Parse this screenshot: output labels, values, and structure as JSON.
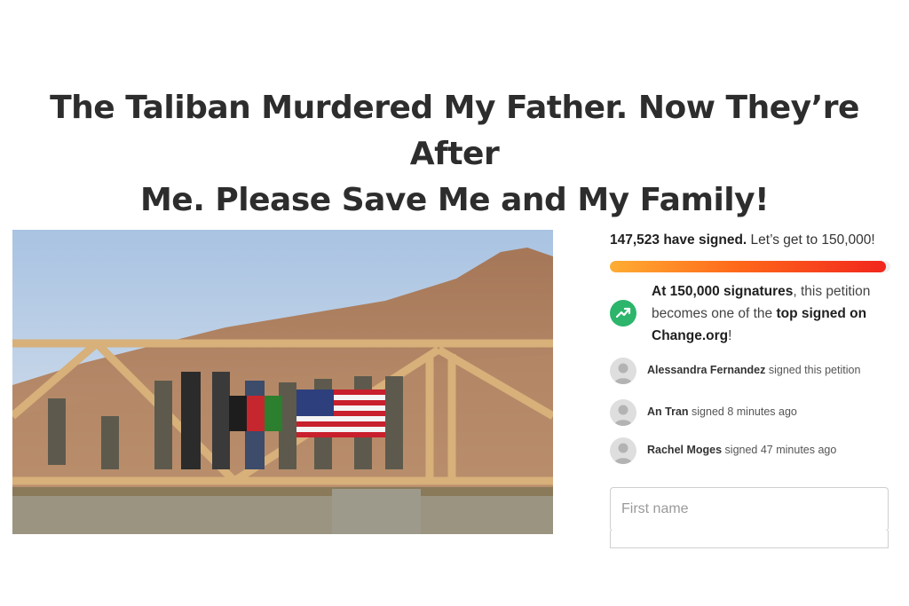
{
  "petition": {
    "title_line1": "The Taliban Murdered My Father. Now They’re After",
    "title_line2": "Me. Please Save Me and My Family!"
  },
  "photo": {
    "description_icon": "petition-photo"
  },
  "signatures": {
    "count_text": "147,523 have signed.",
    "goal_text": " Let’s get to 150,000!",
    "progress": 0.983,
    "progress_colors": [
      "#ffad33",
      "#ff6a1a",
      "#f1261d"
    ]
  },
  "milestone": {
    "icon": "trending-up-icon",
    "icon_color": "#2cb56b",
    "bold1": "At 150,000 signatures",
    "text1": ", this petition becomes one of the ",
    "bold2": "top signed on Change.org",
    "text2": "!"
  },
  "recent_signers": [
    {
      "name": "Alessandra Fernandez",
      "action": " signed this petition"
    },
    {
      "name": "An Tran",
      "action": " signed 8 minutes ago"
    },
    {
      "name": "Rachel Moges",
      "action": " signed 47 minutes ago"
    }
  ],
  "form": {
    "first_name_placeholder": "First name",
    "last_name_placeholder": ""
  }
}
